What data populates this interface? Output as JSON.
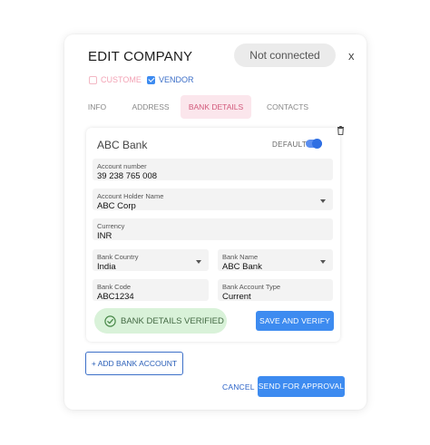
{
  "header": {
    "title": "EDIT COMPANY",
    "status": "Not connected",
    "close_symbol": "x"
  },
  "company_types": [
    {
      "label": "CUSTOME",
      "checked": false
    },
    {
      "label": "VENDOR",
      "checked": true
    }
  ],
  "tabs": [
    {
      "label": "INFO",
      "active": false
    },
    {
      "label": "ADDRESS",
      "active": false
    },
    {
      "label": "BANK DETAILS",
      "active": true
    },
    {
      "label": "CONTACTS",
      "active": false
    }
  ],
  "bank_card": {
    "bank_name": "ABC Bank",
    "default_label": "DEFAULT",
    "default_on": true,
    "fields": {
      "account_number": {
        "label": "Account number",
        "value": "39 238 765 008"
      },
      "account_holder": {
        "label": "Account Holder Name",
        "value": "ABC Corp"
      },
      "currency": {
        "label": "Currency",
        "value": "INR"
      },
      "bank_country": {
        "label": "Bank Country",
        "value": "India"
      },
      "bank_name_field": {
        "label": "Bank Name",
        "value": "ABC Bank"
      },
      "bank_code": {
        "label": "Bank Code",
        "value": "ABC1234"
      },
      "account_type": {
        "label": "Bank Account Type",
        "value": "Current"
      }
    },
    "verified_text": "BANK DETAILS VERIFIED",
    "save_verify_label": "SAVE AND VERIFY"
  },
  "actions": {
    "add_bank_label": "+ ADD BANK ACCOUNT",
    "cancel_label": "CANCEL",
    "send_label": "SEND FOR APPROVAL"
  },
  "colors": {
    "accent": "#3d8bf0",
    "tab_active_bg": "#fbe6ec",
    "tab_active_text": "#d2587a",
    "verified_bg": "#d9f2d9",
    "pill_bg": "#ebebeb"
  }
}
